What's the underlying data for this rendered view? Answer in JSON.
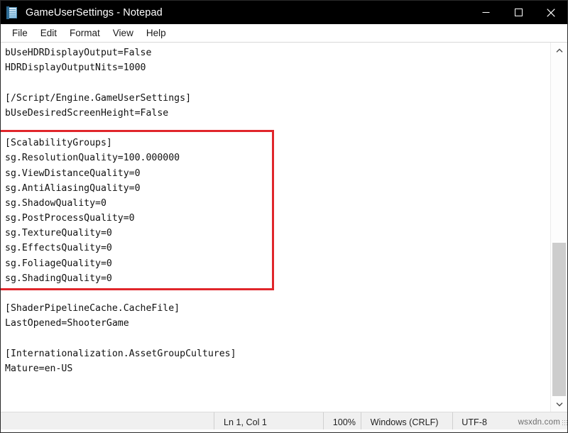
{
  "window": {
    "title": "GameUserSettings - Notepad",
    "icon": "notepad-icon",
    "controls": {
      "minimize": "minimize-icon",
      "maximize": "maximize-icon",
      "close": "close-icon"
    }
  },
  "menubar": {
    "items": [
      {
        "label": "File"
      },
      {
        "label": "Edit"
      },
      {
        "label": "Format"
      },
      {
        "label": "View"
      },
      {
        "label": "Help"
      }
    ]
  },
  "document": {
    "lines": [
      "bUseHDRDisplayOutput=False",
      "HDRDisplayOutputNits=1000",
      "",
      "[/Script/Engine.GameUserSettings]",
      "bUseDesiredScreenHeight=False",
      "",
      "[ScalabilityGroups]",
      "sg.ResolutionQuality=100.000000",
      "sg.ViewDistanceQuality=0",
      "sg.AntiAliasingQuality=0",
      "sg.ShadowQuality=0",
      "sg.PostProcessQuality=0",
      "sg.TextureQuality=0",
      "sg.EffectsQuality=0",
      "sg.FoliageQuality=0",
      "sg.ShadingQuality=0",
      "",
      "[ShaderPipelineCache.CacheFile]",
      "LastOpened=ShooterGame",
      "",
      "[Internationalization.AssetGroupCultures]",
      "Mature=en-US"
    ]
  },
  "annotation": {
    "highlight_color": "#e0262b",
    "highlight_target": "[ScalabilityGroups] section"
  },
  "scrollbar": {
    "up_arrow": "chevron-up-icon",
    "down_arrow": "chevron-down-icon"
  },
  "statusbar": {
    "cursor": "Ln 1, Col 1",
    "zoom": "100%",
    "line_endings": "Windows (CRLF)",
    "encoding": "UTF-8",
    "watermark": "wsxdn.com"
  }
}
